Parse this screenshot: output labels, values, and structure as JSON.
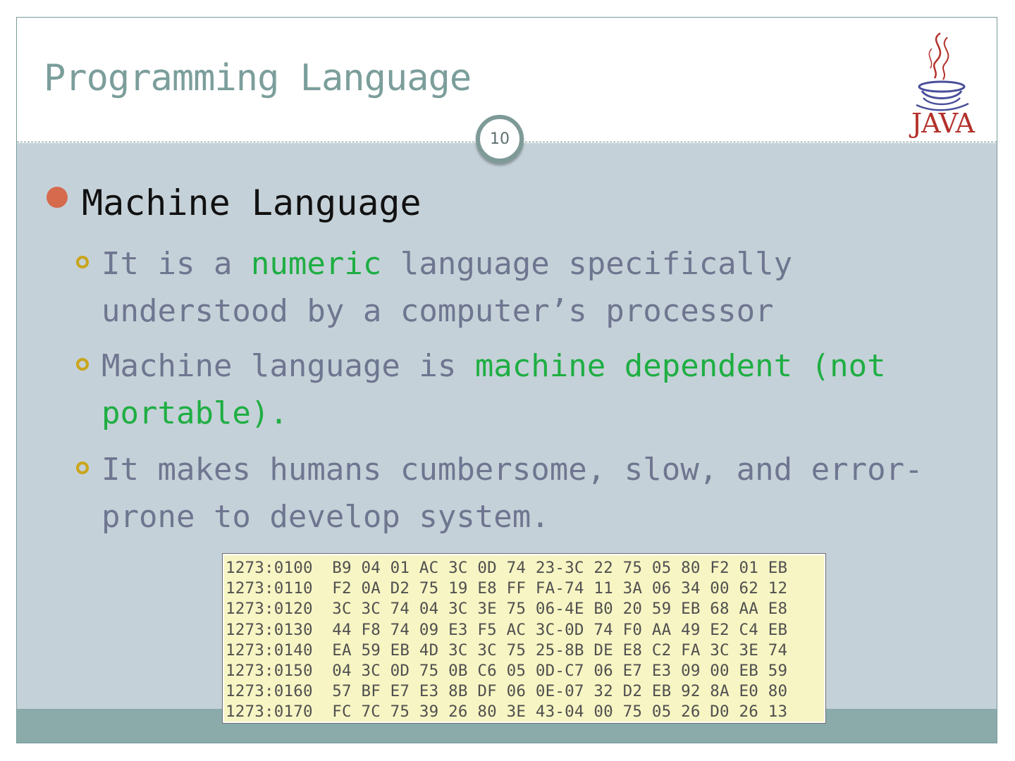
{
  "slide": {
    "title": "Programming Language",
    "page_number": "10",
    "logo_text": "JAVA"
  },
  "content": {
    "heading": "Machine Language",
    "bullets": [
      {
        "pre": "It is a ",
        "highlight": "numeric",
        "post": " language specifically understood by a computer’s processor"
      },
      {
        "pre": "Machine language is ",
        "highlight": "machine dependent (not portable).",
        "post": ""
      },
      {
        "pre": "It makes humans cumbersome, slow, and error-prone to develop system.",
        "highlight": "",
        "post": ""
      }
    ]
  },
  "hex_dump": {
    "rows": [
      "1273:0100  B9 04 01 AC 3C 0D 74 23-3C 22 75 05 80 F2 01 EB",
      "1273:0110  F2 0A D2 75 19 E8 FF FA-74 11 3A 06 34 00 62 12",
      "1273:0120  3C 3C 74 04 3C 3E 75 06-4E B0 20 59 EB 68 AA E8",
      "1273:0130  44 F8 74 09 E3 F5 AC 3C-0D 74 F0 AA 49 E2 C4 EB",
      "1273:0140  EA 59 EB 4D 3C 3C 75 25-8B DE E8 C2 FA 3C 3E 74",
      "1273:0150  04 3C 0D 75 0B C6 05 0D-C7 06 E7 E3 09 00 EB 59",
      "1273:0160  57 BF E7 E3 8B DF 06 0E-07 32 D2 EB 92 8A E0 80",
      "1273:0170  FC 7C 75 39 26 80 3E 43-04 00 75 05 26 D0 26 13"
    ]
  },
  "colors": {
    "title": "#7b9e9b",
    "body_bg": "#c5d1d8",
    "footer": "#8aabaa",
    "highlight": "#1eae43",
    "bullet_main": "#d56a4d",
    "bullet_sub": "#c9a51a"
  }
}
